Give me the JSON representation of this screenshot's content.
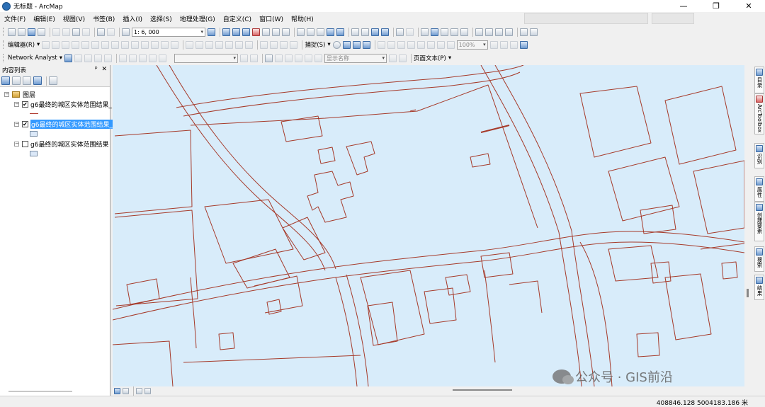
{
  "window": {
    "title": "无标题 - ArcMap",
    "controls": [
      "—",
      "❐",
      "✕"
    ]
  },
  "menu": [
    "文件(F)",
    "编辑(E)",
    "视图(V)",
    "书签(B)",
    "插入(I)",
    "选择(S)",
    "地理处理(G)",
    "自定义(C)",
    "窗口(W)",
    "帮助(H)"
  ],
  "toolbar": {
    "scale": "1: 6, 000"
  },
  "toolbar2": {
    "editor": "编辑器(R)",
    "snapping": "捕捉(S)",
    "zoom": "100%"
  },
  "toolbar3": {
    "network_analyst": "Network Analyst",
    "display_name": "显示名称",
    "page_text": "页面文本(P)"
  },
  "toc": {
    "title": "内容列表",
    "pin": "ᵖ",
    "close": "✕",
    "group": "图层",
    "layers": [
      {
        "name": "g6最终的城区实体范围结果_",
        "checked": "✔",
        "expander": "⊟"
      },
      {
        "name": "g6最终的城区实体范围结果_",
        "checked": "✔",
        "expander": "⊟"
      },
      {
        "name": "g6最终的城区实体范围结果",
        "checked": "",
        "expander": "⊟"
      }
    ]
  },
  "right_dock": [
    {
      "label": "目录",
      "icon": "catalog-icon"
    },
    {
      "label": "ArcToolbox",
      "icon": "toolbox-icon"
    },
    {
      "label": "识别",
      "icon": "identify-icon"
    },
    {
      "label": "属性",
      "icon": "attributes-icon"
    },
    {
      "label": "创建要素",
      "icon": "create-features-icon"
    },
    {
      "label": "搜索",
      "icon": "search-icon"
    },
    {
      "label": "结果",
      "icon": "results-icon"
    }
  ],
  "status": {
    "coordinates": "408846.128  5004183.186 米"
  },
  "watermark": "公众号 · GIS前沿",
  "colors": {
    "map_fill": "#d8ecfa",
    "line": "#a63a2a",
    "selection": "#3399ff"
  }
}
